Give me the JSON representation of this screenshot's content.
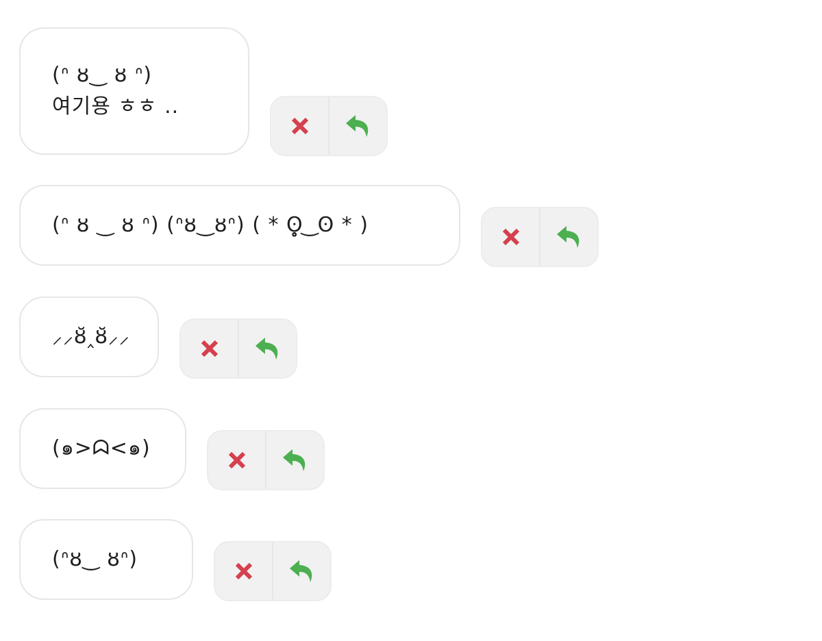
{
  "colors": {
    "delete": "#d5404e",
    "reply": "#4caf50",
    "bubble_border": "#e6e6e6",
    "actions_bg": "#f1f1f1"
  },
  "icons": {
    "delete": "close-icon",
    "reply": "reply-arrow-icon"
  },
  "messages": [
    {
      "lines": [
        "(ᐢ ȣ‿ ȣ ᐢ)",
        "여기용 ㅎㅎ .."
      ]
    },
    {
      "lines": [
        "(ᐢ ȣ ‿ ȣ ᐢ) (ᐢȣ‿ȣᐢ) ( * ʘ̥̥̥̥̥̥̥̥̥̥̥̥̥̥̥̥̥̥̥̥̥̥̥̥̥̥̥̥̥̥ ͜ ʘ * )"
      ]
    },
    {
      "lines": [
        "⸝⸝ȣ̆‸ȣ̆⸝⸝"
      ]
    },
    {
      "lines": [
        "(๑>ᗣ<๑)"
      ]
    },
    {
      "lines": [
        "(ᐢȣ‿ ȣᐢ)"
      ]
    }
  ]
}
